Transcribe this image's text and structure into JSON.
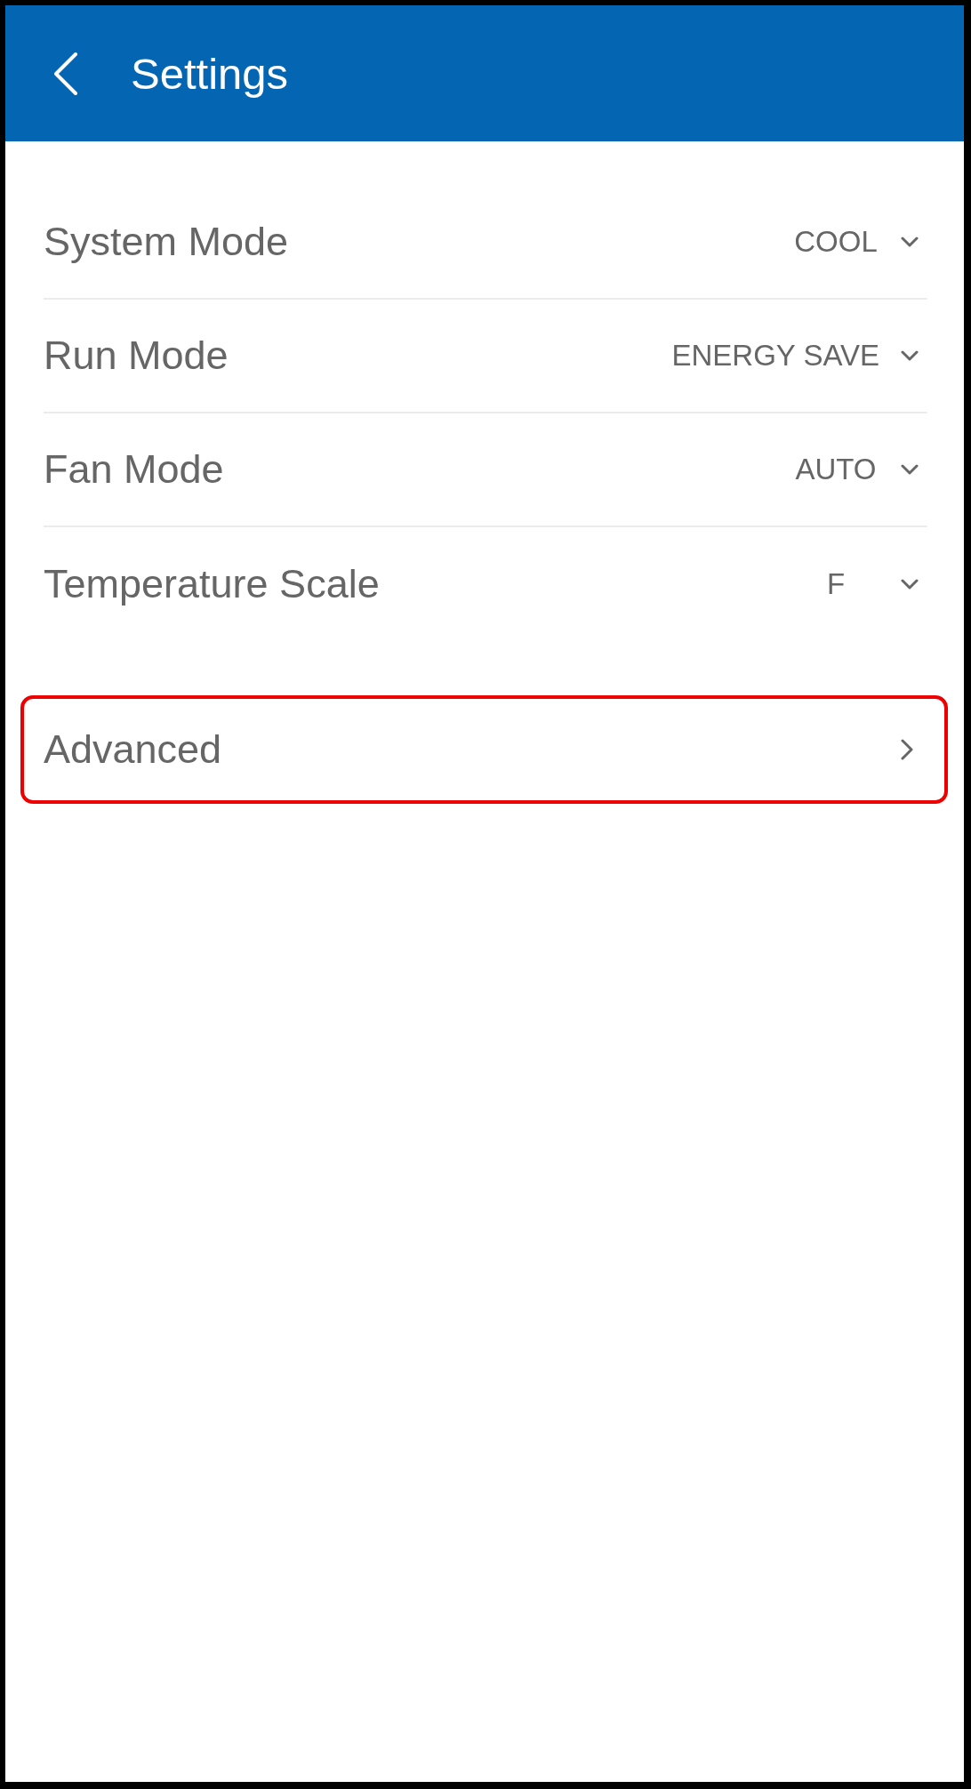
{
  "header": {
    "title": "Settings"
  },
  "settings": [
    {
      "label": "System Mode",
      "value": "COOL"
    },
    {
      "label": "Run Mode",
      "value": "ENERGY SAVE"
    },
    {
      "label": "Fan Mode",
      "value": "AUTO"
    },
    {
      "label": "Temperature Scale",
      "value": "F"
    }
  ],
  "advanced": {
    "label": "Advanced",
    "highlighted": true
  }
}
